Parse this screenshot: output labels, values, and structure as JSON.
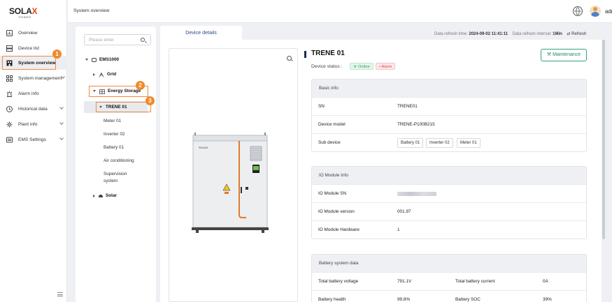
{
  "brand": {
    "logo_text_a": "SOLA",
    "logo_text_x": "X",
    "logo_sub": "POWER"
  },
  "sidebar": {
    "items": [
      {
        "label": "Overview",
        "icon": "dashboard-icon"
      },
      {
        "label": "Device list",
        "icon": "server-icon"
      },
      {
        "label": "System overview",
        "icon": "building-icon",
        "active": true
      },
      {
        "label": "System management",
        "icon": "grid-icon",
        "has_chevron": true
      },
      {
        "label": "Alarm info",
        "icon": "alarm-icon"
      },
      {
        "label": "Historical data",
        "icon": "history-icon",
        "has_chevron": true
      },
      {
        "label": "Plant info",
        "icon": "gear-icon",
        "has_chevron": true
      },
      {
        "label": "EMS Settings",
        "icon": "ems-icon",
        "has_chevron": true
      }
    ],
    "badges": [
      "1",
      "2",
      "3"
    ]
  },
  "header": {
    "breadcrumb": "System overview",
    "user": "admin"
  },
  "tree": {
    "search_placeholder": "Please enter",
    "nodes": {
      "ems": "EMS1000",
      "grid": "Grid",
      "storage": "Energy Storage",
      "trene": "TRENE 01",
      "meter": "Meter 01",
      "inverter": "Inverter 02",
      "battery": "Battery 01",
      "aircon": "Air conditioning",
      "supervision": "Supervision system",
      "solar": "Solar"
    }
  },
  "tabs": {
    "device_details": "Device details"
  },
  "refresh": {
    "time_label": "Data refresh time:",
    "time_value": "2024-09-02 11:41:11",
    "interval_label": "Data refresh interval:",
    "interval_value": "1Min",
    "refresh_button": "Refresh"
  },
  "device": {
    "title": "TRENE 01",
    "status_label": "Device status :",
    "online": "Online",
    "alarm": "Alarm",
    "maintenance": "Maintenance"
  },
  "basic_info": {
    "header": "Basic info",
    "sn_label": "SN",
    "sn_value": "TRENE01",
    "model_label": "Device model",
    "model_value": "TRENE-P100B215",
    "sub_label": "Sub device",
    "sub_devices": [
      "Battery 01",
      "Inverter 02",
      "Meter 01"
    ]
  },
  "io_module": {
    "header": "IO Module Info",
    "sn_label": "IO Module SN",
    "version_label": "IO Module version",
    "version_value": "001.97",
    "hw_label": "IO Module Hardware",
    "hw_value": "1"
  },
  "battery_system": {
    "header": "Battery system data",
    "voltage_label": "Total battery voltage",
    "voltage_value": "791.1V",
    "current_label": "Total battery current",
    "current_value": "0A",
    "health_label": "Battery health",
    "health_value": "99.8%",
    "soc_label": "Battery SOC",
    "soc_value": "39%"
  },
  "colors": {
    "accent": "#f08a2e",
    "brand_red": "#e8401c",
    "online_green": "#25a25a",
    "alarm_red": "#e14545",
    "maintenance_green": "#2fa37a"
  }
}
